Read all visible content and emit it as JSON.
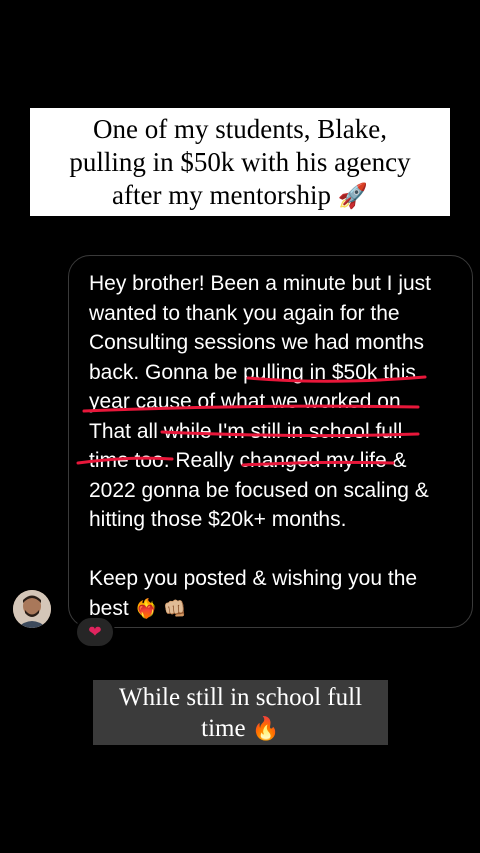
{
  "top_caption": {
    "lines": [
      "One of my students, Blake,",
      "pulling in $50k with his agency",
      "after my mentorship"
    ],
    "emoji": "🚀"
  },
  "message": {
    "lines": [
      "Hey brother! Been a minute but I just",
      "wanted to thank you again for the",
      "Consulting sessions we had months",
      "back. Gonna be pulling in $50k this",
      "year cause of what we worked on.",
      "That all while I'm still in school full",
      "time too. Really changed my life &",
      "2022 gonna be focused on scaling &",
      "hitting those $20k+ months.",
      "Keep you posted & wishing you the",
      "best"
    ],
    "end_emojis": "❤️‍🔥 👊🏼"
  },
  "reaction": {
    "emoji": "❤"
  },
  "bottom_caption": {
    "lines": [
      "While still in school full",
      "time"
    ],
    "emoji": "🔥"
  },
  "colors": {
    "underline": "#e8173a",
    "caption_bg": "#3b3b3b",
    "bubble_border": "#3a3a3a"
  },
  "icons": {
    "avatar": "profile-photo"
  }
}
